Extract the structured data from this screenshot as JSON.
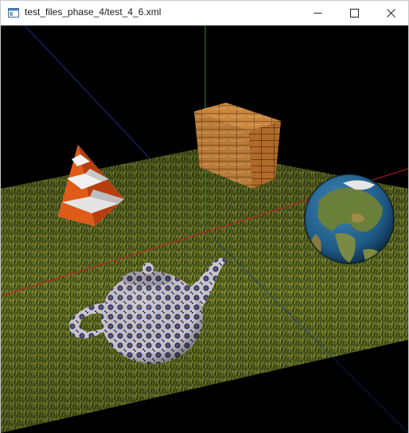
{
  "window": {
    "title": "test_files_phase_4/test_4_6.xml"
  },
  "controls": {
    "minimize_icon": "minimize-icon",
    "maximize_icon": "maximize-icon",
    "close_icon": "close-icon"
  },
  "scene": {
    "background": "#000000",
    "objects": [
      "ground-plane",
      "traffic-cone",
      "wooden-crate",
      "globe",
      "teapot"
    ],
    "axis_colors": {
      "x": "#c81e1e",
      "y": "#1e9b1e",
      "z": "#1e2a8c"
    }
  }
}
